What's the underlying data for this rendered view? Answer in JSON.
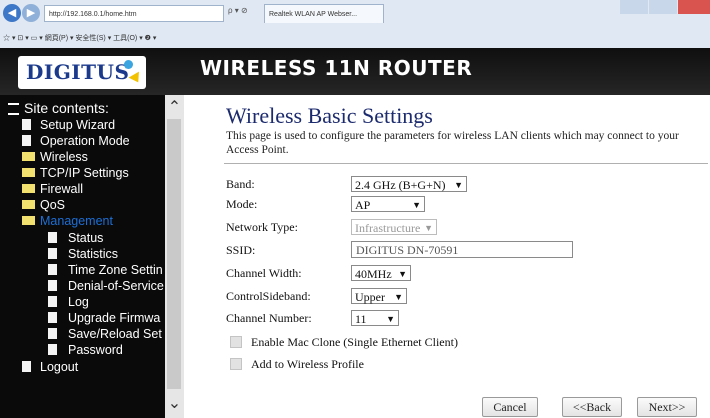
{
  "browser": {
    "address": "http://192.168.0.1/home.htm",
    "address_tools": "ρ ▾ ⊘",
    "tab_title": "Realtek WLAN AP Webser...",
    "command_bar": "☆ ▾ ⊡ ▾ ▭ ▾ 網頁(P) ▾ 安全性(S) ▾ 工具(O) ▾ ❷ ▾"
  },
  "header": {
    "logo_text": "DIGITUS",
    "title": "WIRELESS 11N ROUTER"
  },
  "sidebar": {
    "root": "Site contents:",
    "items": [
      {
        "label": "Setup Wizard"
      },
      {
        "label": "Operation Mode"
      },
      {
        "label": "Wireless"
      },
      {
        "label": "TCP/IP Settings"
      },
      {
        "label": "Firewall"
      },
      {
        "label": "QoS"
      },
      {
        "label": "Management"
      },
      {
        "label": "Status"
      },
      {
        "label": "Statistics"
      },
      {
        "label": "Time Zone Settin"
      },
      {
        "label": "Denial-of-Service"
      },
      {
        "label": "Log"
      },
      {
        "label": "Upgrade Firmwa"
      },
      {
        "label": "Save/Reload Set"
      },
      {
        "label": "Password"
      },
      {
        "label": "Logout"
      }
    ]
  },
  "main": {
    "title": "Wireless  Basic Settings",
    "intro": "This page is used to configure the parameters for wireless LAN clients which may connect to your Access Point.",
    "fields": {
      "band": {
        "label": "Band:",
        "value": "2.4 GHz (B+G+N)"
      },
      "mode": {
        "label": "Mode:",
        "value": "AP"
      },
      "network_type": {
        "label": "Network Type:",
        "value": "Infrastructure"
      },
      "ssid": {
        "label": "SSID:",
        "value": "DIGITUS DN-70591"
      },
      "channel_width": {
        "label": "Channel Width:",
        "value": "40MHz"
      },
      "control_sideband": {
        "label": "ControlSideband:",
        "value": "Upper"
      },
      "channel_number": {
        "label": "Channel Number:",
        "value": "11"
      }
    },
    "checkboxes": {
      "mac_clone": "Enable Mac Clone (Single Ethernet Client)",
      "wireless_profile": "Add to Wireless Profile"
    },
    "buttons": {
      "cancel": "Cancel",
      "back": "<<Back",
      "next": "Next>>"
    }
  },
  "colors": {
    "header_bg": "#1a1a1a",
    "sidebar_bg": "#0a0a0a",
    "title_color": "#1c2b6e",
    "active_item": "#1d6fd6",
    "logo_blue": "#1b3a8c"
  }
}
